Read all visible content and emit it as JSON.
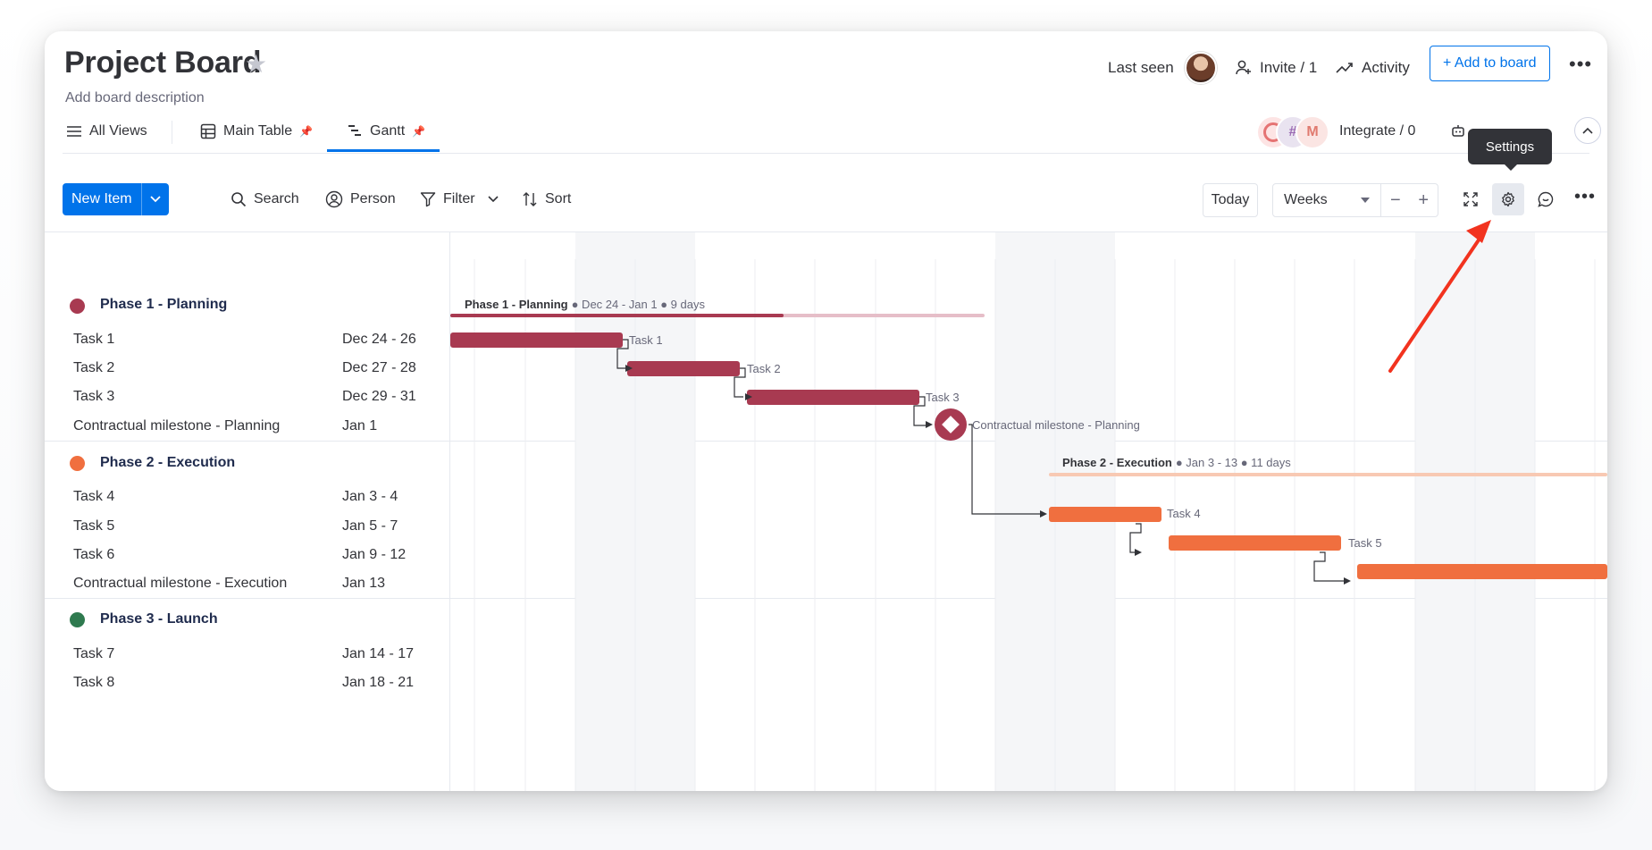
{
  "header": {
    "title": "Project Board",
    "description": "Add board description",
    "last_seen": "Last seen",
    "invite": "Invite / 1",
    "activity": "Activity",
    "add_to_board": "+ Add to board"
  },
  "tabs": [
    {
      "label": "All Views"
    },
    {
      "label": "Main Table"
    },
    {
      "label": "Gantt"
    }
  ],
  "integrate": "Integrate / 0",
  "toolbar": {
    "new_item": "New Item",
    "search": "Search",
    "person": "Person",
    "filter": "Filter",
    "sort": "Sort",
    "today": "Today",
    "zoom": "Weeks",
    "tooltip": "Settings"
  },
  "colors": {
    "phase1": "#a83a51",
    "phase1_light": "#e6bec8",
    "phase2": "#f06f3f",
    "phase2_light": "#f8c9b3",
    "phase3": "#2f7a4f",
    "accent": "#0073ea"
  },
  "groups": [
    {
      "name": "Phase 1 - Planning",
      "color": "#a83a51",
      "summary_name": "Phase 1 - Planning",
      "summary_info": "● Dec 24 - Jan 1 ● 9 days",
      "tasks": [
        {
          "name": "Task 1",
          "date": "Dec 24 - 26"
        },
        {
          "name": "Task 2",
          "date": "Dec 27 - 28"
        },
        {
          "name": "Task 3",
          "date": "Dec 29 - 31"
        },
        {
          "name": "Contractual milestone - Planning",
          "date": "Jan 1"
        }
      ]
    },
    {
      "name": "Phase 2 - Execution",
      "color": "#f06f3f",
      "summary_name": "Phase 2 - Execution",
      "summary_info": "● Jan 3 - 13 ● 11 days",
      "tasks": [
        {
          "name": "Task 4",
          "date": "Jan 3 - 4"
        },
        {
          "name": "Task 5",
          "date": "Jan 5 - 7"
        },
        {
          "name": "Task 6",
          "date": "Jan 9 - 12"
        },
        {
          "name": "Contractual milestone - Execution",
          "date": "Jan 13"
        }
      ]
    },
    {
      "name": "Phase 3 - Launch",
      "color": "#2f7a4f",
      "tasks": [
        {
          "name": "Task 7",
          "date": "Jan 14 - 17"
        },
        {
          "name": "Task 8",
          "date": "Jan 18 - 21"
        }
      ]
    }
  ]
}
